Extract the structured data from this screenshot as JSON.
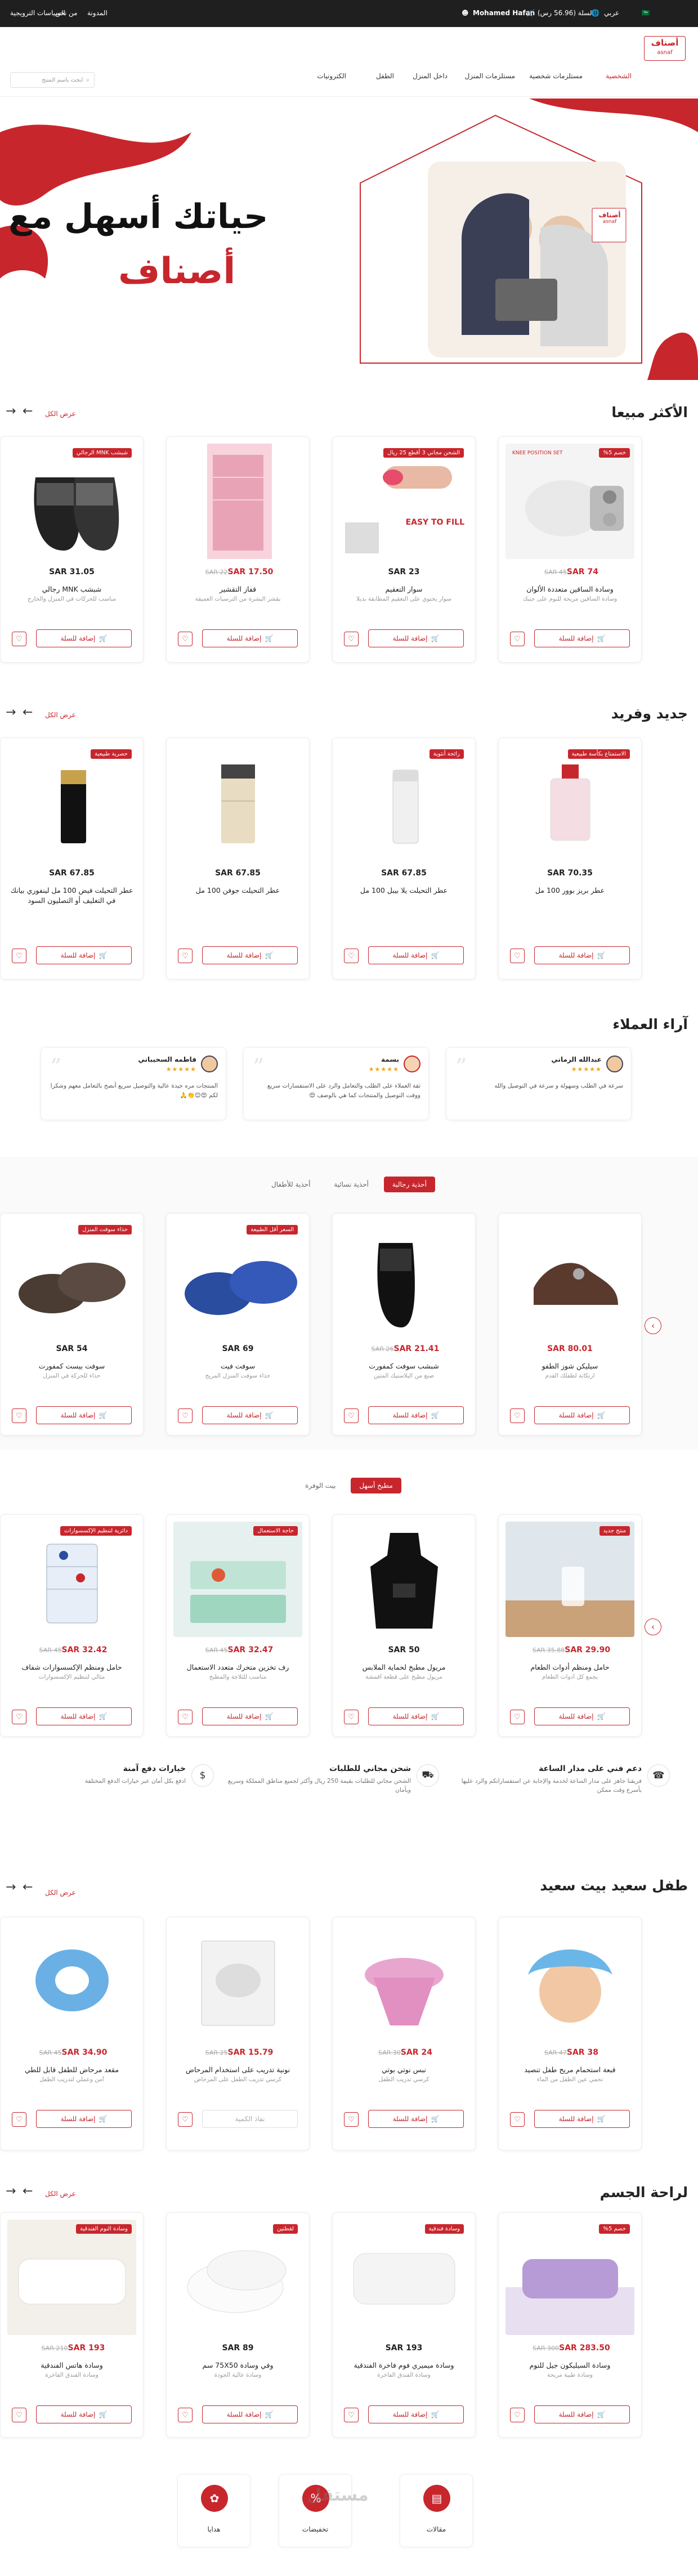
{
  "topbar": {
    "links": [
      "السياسات الترويجية",
      "من نحن",
      "المدونة"
    ],
    "language": "عربي",
    "currency_flag": "🇸🇦",
    "cart": "السلة (56.96 رس)",
    "user": "Mohamed Hafan"
  },
  "header": {
    "logo_ar": "أصناف",
    "logo_en": "asnaf",
    "search_placeholder": "ابحث باسم المنتج",
    "nav": [
      "الشخصية",
      "مستلزمات شخصية",
      "مستلزمات المنزل",
      "داخل المنزل",
      "الطفل",
      "الكترونيات"
    ],
    "nav_active": 0
  },
  "hero": {
    "headline": "حياتك أسهل مع",
    "brand": "أصناف",
    "logo_ar": "أصناف",
    "logo_en": "asnaf"
  },
  "colors": {
    "brand": "#c8262d",
    "dark": "#1f1f1f"
  },
  "labels": {
    "add": "إضافة للسلة",
    "out": "نفاذ الكمية",
    "view_all": "عرض الكل"
  },
  "sections": {
    "best_sellers": {
      "title": "الأكثر مبيعا",
      "products": [
        {
          "badge": "خصم 5%",
          "price": "SAR 74",
          "old": "SAR 45",
          "name": "وسادة الساقين متعددة الألوان",
          "desc": "وسادة الساقين مريحة للنوم على جنبك",
          "promo": "KNEE POSITION SET"
        },
        {
          "badge": "الشحن مجاني 3 أقطع 25 ريال",
          "price": "SAR 23",
          "old": "",
          "name": "سوار التعقيم",
          "desc": "سوار يحتوي على التعقيم المطابقة بديلا",
          "promo": "EASY TO FILL"
        },
        {
          "badge": "",
          "price": "SAR 17.50",
          "old": "SAR 22",
          "name": "قفاز التقشير",
          "desc": "يقشر البشرة من الترسبات العميقة"
        },
        {
          "badge": "شبشب MNK الرجالي",
          "price": "SAR 31.05",
          "old": "",
          "name": "شبشب MNK رجالي",
          "desc": "مناسب للحركات في المنزل والخارج"
        }
      ]
    },
    "new_unique": {
      "title": "جديد وفريد",
      "products": [
        {
          "badge": "الاستمتاع بكأسة طبيعية",
          "price": "SAR 70.35",
          "name": "عطر بريز بوور 100 مل"
        },
        {
          "badge": "رائحة أنثوية",
          "price": "SAR 67.85",
          "name": "عطر التحيلت يلا بيبل 100 مل"
        },
        {
          "badge": "",
          "price": "SAR 67.85",
          "name": "عطر التحيلت جوفن 100 مل"
        },
        {
          "badge": "حصرية طبيعية",
          "price": "SAR 67.85",
          "name": "عطر التحيلت فيض 100 مل لينفوري بيانك في التغليف أو التصليون السود"
        }
      ]
    },
    "reviews": {
      "title": "آراء العملاء",
      "items": [
        {
          "name": "عبدالله الرماني",
          "stars": "★★★★★",
          "text": "سرعة في الطلب وسهولة و سرعة في التوصيل والله"
        },
        {
          "name": "بسمة",
          "stars": "★★★★★",
          "text": "ثقة العملاء على الطلب والتعامل والرد على الاستفسارات سريع ووقت التوصيل والمنتجات كما هي بالوصف 😍"
        },
        {
          "name": "فاطمه السحيباني",
          "stars": "★★★★★",
          "text": "المنتجات مره جيدة عالية والتوصيل سريع أنصح بالتعامل معهم وشكرا لكم 😍😊👏🙏"
        }
      ]
    },
    "shoes": {
      "tabs": [
        "أحذية رجالية",
        "أحذية نسائية",
        "أحذية للأطفال"
      ],
      "active": 0,
      "products": [
        {
          "badge": "",
          "price": "SAR 80.01",
          "old": "",
          "name": "سيليكن شوز الطفو",
          "desc": "ارتكانة لطفلك القدم"
        },
        {
          "badge": "",
          "price": "SAR 21.41",
          "old": "SAR 26",
          "name": "شبشب سوفت كمفورت",
          "desc": "صنع من البلاستيك المتين"
        },
        {
          "badge": "السعر أقل الطبيعة",
          "price": "SAR 69",
          "old": "",
          "name": "سوفت فيت",
          "desc": "حذاء سوفت المنزل المريح"
        },
        {
          "badge": "حذاء سوفت المنزل",
          "price": "SAR 54",
          "old": "",
          "name": "سوفت بيست كمفورت",
          "desc": "حذاء للحركة في المنزل"
        }
      ]
    },
    "kitchen": {
      "tabs": [
        "مطبخ أسهل",
        "بيت الوفرة"
      ],
      "active": 0,
      "products": [
        {
          "badge": "منتج جديد",
          "price": "SAR 29.90",
          "old": "SAR 35.88",
          "name": "حامل ومنظم أدوات الطعام",
          "desc": "يجمع كل أدوات الطعام"
        },
        {
          "badge": "",
          "price": "SAR 50",
          "old": "",
          "name": "مريول مطبخ لحماية الملابس",
          "desc": "مريول مطبخ على قطعة أقمشة"
        },
        {
          "badge": "حاجة الاستعمال",
          "price": "SAR 32.47",
          "old": "SAR 45",
          "name": "رف تخزين متحرك متعدد الاستعمال",
          "desc": "مناسب للثلاجة والمطبخ"
        },
        {
          "badge": "دائرية لتنظيم الإكسسوارات",
          "price": "SAR 32.42",
          "old": "SAR 45",
          "name": "حامل ومنظم الإكسسوارات شفاف",
          "desc": "مثالي لتنظيم الإكسسوارات"
        }
      ]
    },
    "features": [
      {
        "title": "دعم فني على مدار الساعة",
        "text": "فريقنا جاهز على مدار الساعة لخدمة والإجابة عن استفساراتكم والرد عليها بأسرع وقت ممكن"
      },
      {
        "title": "شحن مجاني للطلبات",
        "text": "الشحن مجاني للطلبات بقيمة 250 ريال وأكثر لجميع مناطق المملكة وسريع وبأمان"
      },
      {
        "title": "خيارات دفع آمنة",
        "text": "ادفع بكل أمان عبر خيارات الدفع المختلفة"
      }
    ],
    "baby": {
      "title": "طفل سعيد بيت سعيد",
      "products": [
        {
          "badge": "",
          "price": "SAR 38",
          "old": "SAR 47",
          "name": "قبعة استحمام مريح طفل تنصيد",
          "desc": "تحمي عين الطفل من الماء"
        },
        {
          "badge": "",
          "price": "SAR 24",
          "old": "SAR 30",
          "name": "نبس نوتي بوتي",
          "desc": "كرسي تدريب الطفل"
        },
        {
          "badge": "",
          "price": "SAR 15.79",
          "old": "SAR 25",
          "name": "نونية تدريب على استخدام المرحاض",
          "desc": "كرسي تدريب الطفل على المرحاض",
          "sold_out": true
        },
        {
          "badge": "",
          "price": "SAR 34.90",
          "old": "SAR 45",
          "name": "مقعد مرحاض للطفل قابل للطي",
          "desc": "آمن وعملي لتدريب الطفل"
        }
      ]
    },
    "comfort": {
      "title": "لراحة الجسم",
      "products": [
        {
          "badge": "خصم 5%",
          "price": "SAR 283.50",
          "old": "SAR 300",
          "name": "وسادة السيليكون جيل للنوم",
          "desc": "وسادة طبية مريحة"
        },
        {
          "badge": "وسادة فندقية",
          "price": "SAR 193",
          "old": "",
          "name": "وسادة ميميري فوم فاخرة الفندقية",
          "desc": "وسادة الفندق الفاخرة"
        },
        {
          "badge": "لقطتين",
          "price": "SAR 89",
          "old": "",
          "name": "وفي وسادة 75X50 سم",
          "desc": "وسادة عالية الجودة"
        },
        {
          "badge": "وسادة النوم الفندقية",
          "price": "SAR 193",
          "old": "SAR 210",
          "name": "وسادة هاتس الفندقية",
          "desc": "وسادة الفندق الفاخرة"
        }
      ]
    },
    "shortcuts": [
      "مقالات",
      "تخفيضات",
      "هدايا"
    ],
    "watermark": "مستقل"
  }
}
